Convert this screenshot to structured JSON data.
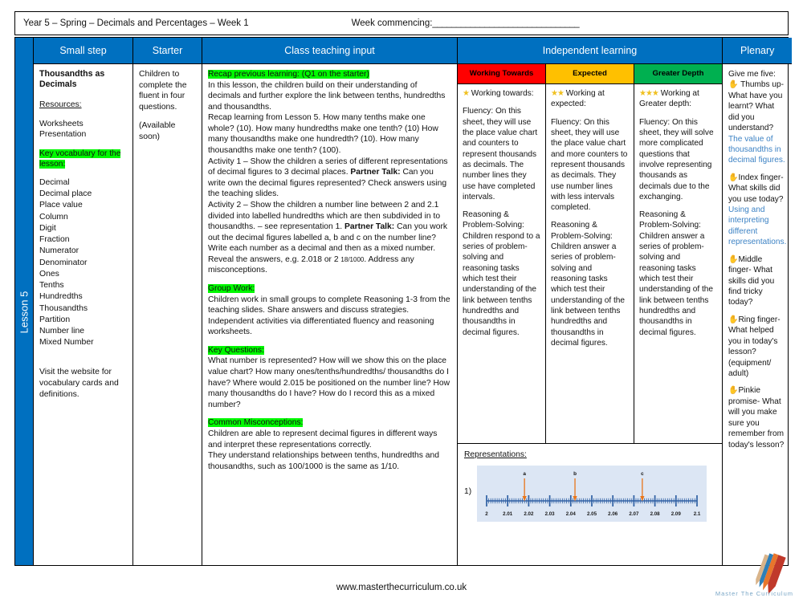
{
  "header": {
    "title": "Year 5 – Spring – Decimals and Percentages – Week 1",
    "week_commencing_label": "Week commencing:",
    "week_commencing_rule": "_______________________________"
  },
  "lesson_tab": "Lesson 5",
  "columns": {
    "small_step": "Small step",
    "starter": "Starter",
    "class_teaching_input": "Class teaching input",
    "independent_learning": "Independent learning",
    "plenary": "Plenary"
  },
  "small_step": {
    "title": "Thousandths as Decimals",
    "resources_heading": "Resources:",
    "resources": [
      "Worksheets",
      "Presentation"
    ],
    "key_vocab_heading": "Key vocabulary for the lesson:",
    "vocabulary": [
      "Decimal",
      "Decimal place",
      "Place value",
      "Column",
      "Digit",
      "Fraction",
      "Numerator",
      "Denominator",
      "Ones",
      "Tenths",
      "Hundredths",
      "Thousandths",
      "Partition",
      "Number line",
      "Mixed Number"
    ],
    "footer_note": "Visit the website for vocabulary cards and definitions."
  },
  "starter": {
    "line1": "Children to complete the fluent in four questions.",
    "line2": "(Available soon)"
  },
  "class_teaching": {
    "recap_heading": "Recap previous learning: (Q1 on the starter)",
    "recap_body": "In this lesson, the children build on their understanding of decimals and further explore the link between tenths, hundredths and thousandths.",
    "recap_body2": "Recap learning from Lesson 5. How many tenths make one whole? (10). How many hundredths make one tenth? (10) How many thousandths make one hundredth? (10). How many thousandths make one tenth? (100).",
    "activity1_a": "Activity 1 – Show the children a series of different representations of decimal figures to 3 decimal places. ",
    "activity1_bold": "Partner Talk:",
    "activity1_b": " Can you write own the decimal figures represented? Check answers using the teaching slides.",
    "activity2_a": "Activity 2 – Show the children a number line between 2 and 2.1 divided into labelled hundredths which are then subdivided in to thousandths. – see representation 1. ",
    "activity2_bold": "Partner Talk:",
    "activity2_b": " Can you work out the decimal figures labelled a, b and c on the number line? Write each number as a decimal and then as a mixed number. Reveal the answers, e.g. 2.018 or 2 ",
    "activity2_fraction": "18/1000",
    "activity2_c": ". Address any misconceptions.",
    "group_work_heading": "Group Work:",
    "group_work_body": "Children work in small groups to complete Reasoning 1-3 from the teaching slides. Share answers and discuss strategies. Independent activities via differentiated fluency and reasoning worksheets.",
    "key_questions_heading": "Key Questions:",
    "key_questions_body": "What number is represented? How will we show this on the place value chart? How many ones/tenths/hundredths/ thousandths do I have? Where would 2.015 be positioned on the number line? How many thousandths do I have? How do I record this as a mixed number?",
    "misconceptions_heading": "Common Misconceptions:",
    "misconceptions_body1": "Children are able to represent decimal figures in different ways and interpret these representations correctly.",
    "misconceptions_body2": "They understand relationships between tenths, hundredths and thousandths, such as 100/1000 is the same as 1/10."
  },
  "independent_learning": [
    {
      "label": "Working Towards",
      "color": "#FF0000",
      "stars": "★",
      "heading": "Working towards:",
      "fluency": "Fluency: On this sheet, they will use the place value chart and counters to represent thousands as decimals. The number lines they use have completed intervals.",
      "reasoning": "Reasoning & Problem-Solving: Children respond to a series of problem-solving and reasoning tasks which test their understanding of the link between tenths hundredths and thousandths in decimal figures."
    },
    {
      "label": "Expected",
      "color": "#FFC000",
      "stars": "★★",
      "heading": "Working at expected:",
      "fluency": "Fluency: On this sheet, they will use the place value chart and more counters to represent thousands as decimals. They use number lines with less intervals completed.",
      "reasoning": "Reasoning & Problem-Solving: Children answer a series of problem-solving and reasoning tasks which test their understanding of the link between tenths hundredths and thousandths in decimal figures."
    },
    {
      "label": "Greater Depth",
      "color": "#00B050",
      "stars": "★★★",
      "heading": "Working at Greater depth:",
      "fluency": "Fluency: On this sheet, they will solve more complicated questions that involve representing thousands as decimals due to the exchanging.",
      "reasoning": "Reasoning & Problem-Solving: Children answer a series of problem-solving and reasoning tasks which test their understanding of the link between tenths hundredths and thousandths in decimal figures."
    }
  ],
  "representations": {
    "title": "Representations:",
    "item_number": "1)"
  },
  "chart_data": {
    "type": "line",
    "title": "Number line 2 to 2.1 with labelled points a, b, c",
    "xlabel": "",
    "ylabel": "",
    "xlim": [
      2,
      2.1
    ],
    "major_tick_labels": [
      "2",
      "2.01",
      "2.02",
      "2.03",
      "2.04",
      "2.05",
      "2.06",
      "2.07",
      "2.08",
      "2.09",
      "2.1"
    ],
    "major_tick_values": [
      2,
      2.01,
      2.02,
      2.03,
      2.04,
      2.05,
      2.06,
      2.07,
      2.08,
      2.09,
      2.1
    ],
    "minor_tick_step": 0.001,
    "annotations": [
      {
        "label": "a",
        "value": 2.018
      },
      {
        "label": "b",
        "value": 2.042
      },
      {
        "label": "c",
        "value": 2.074
      }
    ],
    "line_color": "#2E5FA3",
    "arrow_color": "#E8751A",
    "background": "#DCE6F4",
    "grid": false,
    "legend": "none"
  },
  "plenary": {
    "intro": "Give me five:",
    "items": [
      {
        "hand": "✋",
        "question": "Thumbs up- What have you learnt? What did you understand?",
        "answer": "The value of thousandths in decimal figures."
      },
      {
        "hand": "✋",
        "question": "Index finger- What skills did you use today?",
        "answer": "Using and interpreting different representations."
      },
      {
        "hand": "✋",
        "question": "Middle finger- What skills did you find tricky today?",
        "answer": ""
      },
      {
        "hand": "✋",
        "question": "Ring finger- What helped you in today's lesson? (equipment/ adult)",
        "answer": ""
      },
      {
        "hand": "✋",
        "question": "Pinkie promise- What will you make sure you remember from today's lesson?",
        "answer": ""
      }
    ]
  },
  "footer": {
    "url": "www.masterthecurriculum.co.uk",
    "logo_text": "Master The Curriculum"
  }
}
